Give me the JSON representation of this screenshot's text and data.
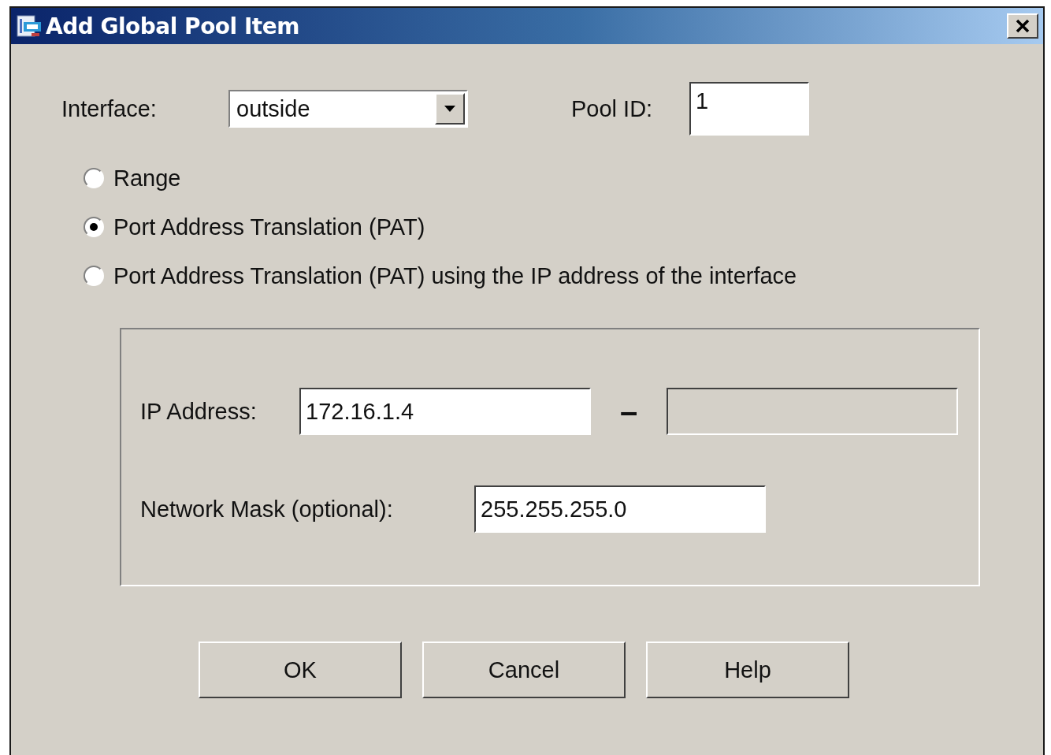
{
  "window": {
    "title": "Add Global Pool Item"
  },
  "interface": {
    "label": "Interface:",
    "value": "outside"
  },
  "pool_id": {
    "label": "Pool ID:",
    "value": "1"
  },
  "options": [
    {
      "label": "Range",
      "selected": false
    },
    {
      "label": "Port Address Translation (PAT)",
      "selected": true
    },
    {
      "label": "Port Address Translation (PAT) using the IP address of the interface",
      "selected": false
    }
  ],
  "ip_address": {
    "label": "IP Address:",
    "value": "172.16.1.4",
    "separator": "–",
    "end": {
      "disabled": true
    }
  },
  "network_mask": {
    "label": "Network Mask (optional):",
    "value": "255.255.255.0"
  },
  "buttons": [
    "OK",
    "Cancel",
    "Help"
  ]
}
